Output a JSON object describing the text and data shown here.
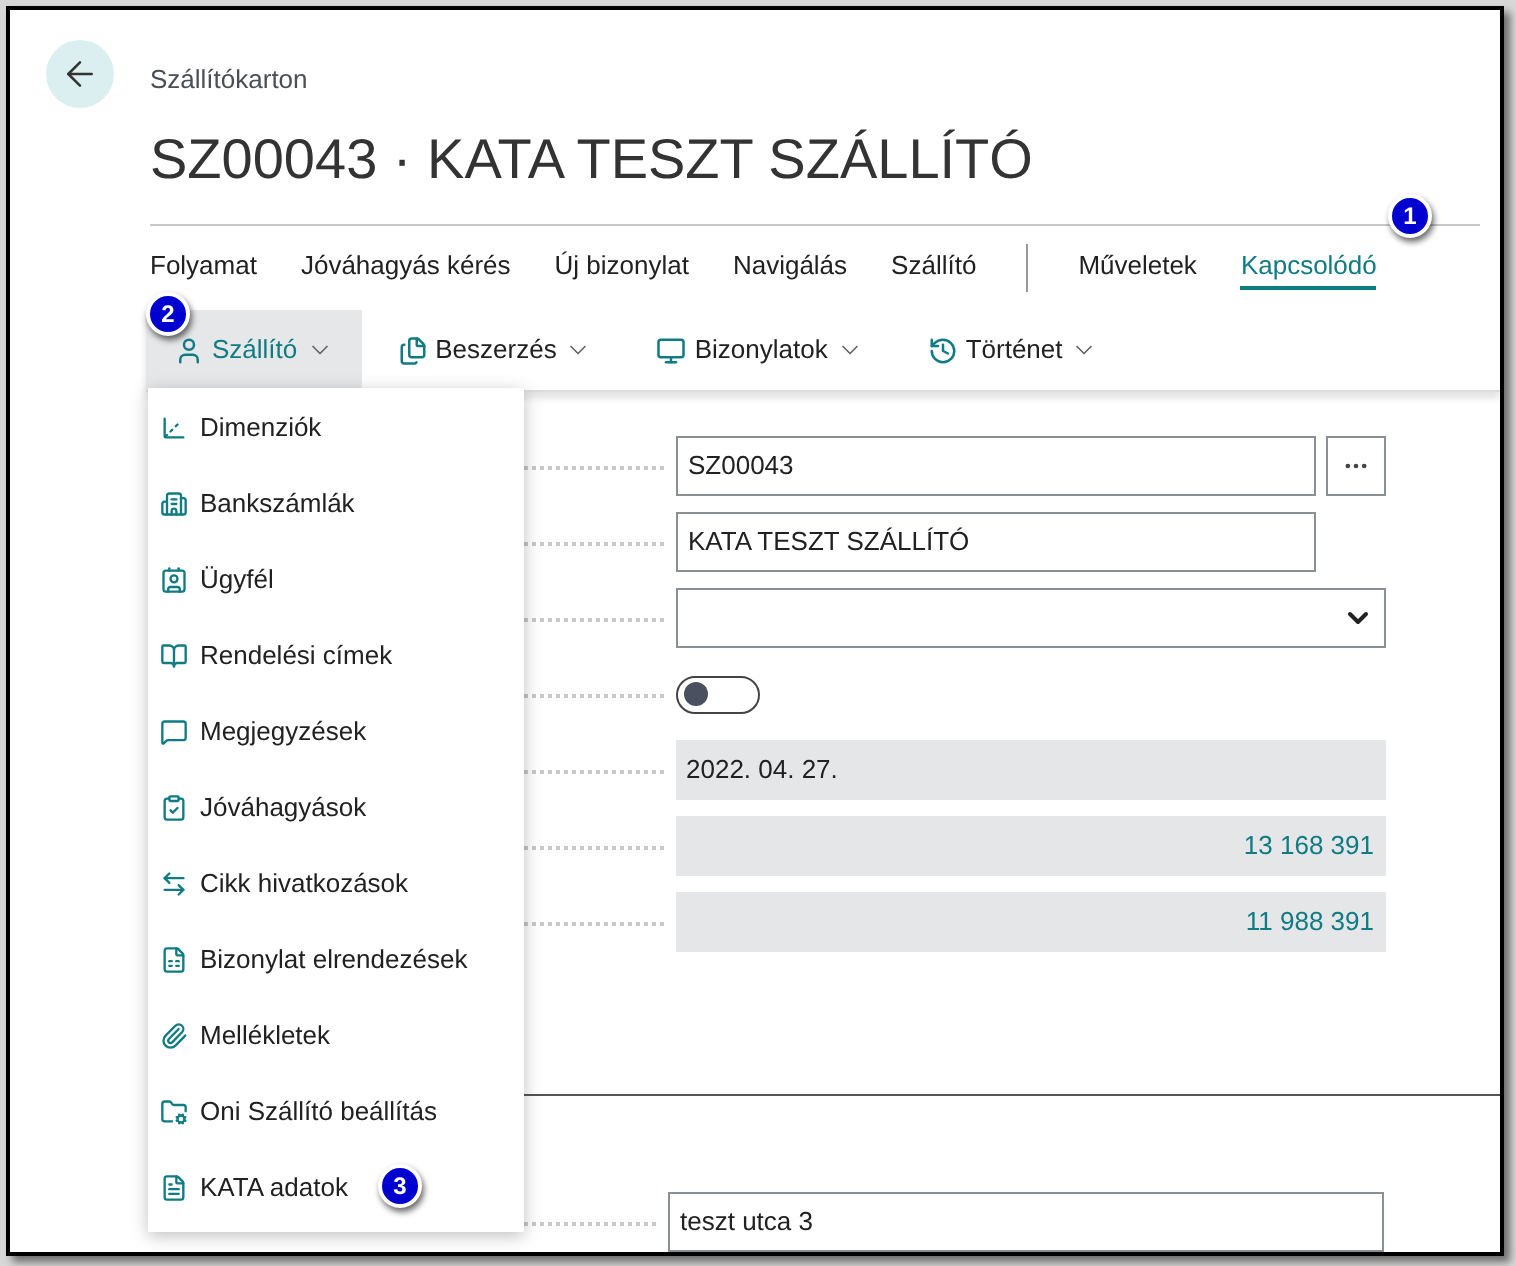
{
  "header": {
    "breadcrumb": "Szállítókarton",
    "title": "SZ00043 · KATA TESZT SZÁLLÍTÓ"
  },
  "action_tab_groups": [
    {
      "tabs": [
        {
          "label": "Folyamat",
          "selected": false
        },
        {
          "label": "Jóváhagyás kérés",
          "selected": false
        },
        {
          "label": "Új bizonylat",
          "selected": false
        },
        {
          "label": "Navigálás",
          "selected": false
        },
        {
          "label": "Szállító",
          "selected": false
        }
      ]
    },
    {
      "tabs": [
        {
          "label": "Műveletek",
          "selected": false
        },
        {
          "label": "Kapcsolódó",
          "selected": true
        }
      ]
    }
  ],
  "subtoolbar": [
    {
      "label": "Szállító",
      "selected": true
    },
    {
      "label": "Beszerzés",
      "selected": false
    },
    {
      "label": "Bizonylatok",
      "selected": false
    },
    {
      "label": "Történet",
      "selected": false
    }
  ],
  "menu": {
    "items": [
      {
        "label": "Dimenziók"
      },
      {
        "label": "Bankszámlák"
      },
      {
        "label": "Ügyfél"
      },
      {
        "label": "Rendelési címek"
      },
      {
        "label": "Megjegyzések"
      },
      {
        "label": "Jóváhagyások"
      },
      {
        "label": "Cikk hivatkozások"
      },
      {
        "label": "Bizonylat elrendezések"
      },
      {
        "label": "Mellékletek"
      },
      {
        "label": "Oni Szállító beállítás"
      },
      {
        "label": "KATA adatok"
      }
    ]
  },
  "form": {
    "fields": [
      {
        "kind": "lookup",
        "value": "SZ00043"
      },
      {
        "kind": "text",
        "value": "KATA TESZT SZÁLLÍTÓ"
      },
      {
        "kind": "select"
      },
      {
        "kind": "toggle",
        "on": false
      },
      {
        "kind": "readonly",
        "value": "2022. 04. 27."
      },
      {
        "kind": "amount",
        "value": "13 168 391"
      },
      {
        "kind": "amount",
        "value": "11 988 391"
      }
    ]
  },
  "address_field": {
    "value": "teszt utca 3"
  },
  "callouts": [
    {
      "label": "1"
    },
    {
      "label": "2"
    },
    {
      "label": "3"
    }
  ]
}
